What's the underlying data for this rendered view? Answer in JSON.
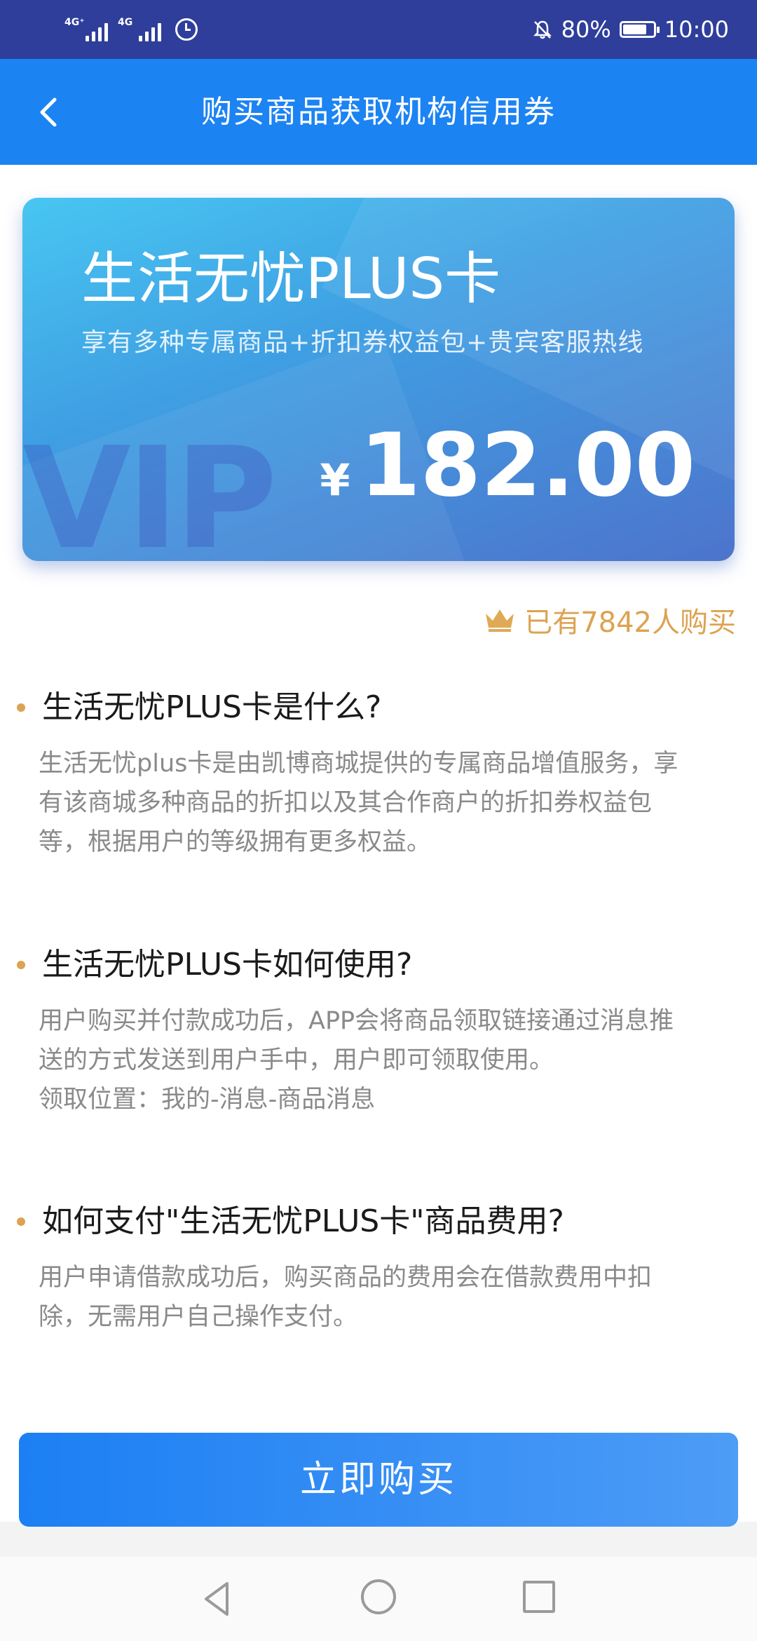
{
  "status_bar": {
    "network1": "4G⁺",
    "network2": "4G",
    "battery_percent": "80%",
    "battery_level": 0.8,
    "time": "10:00"
  },
  "header": {
    "title": "购买商品获取机构信用券"
  },
  "card": {
    "title": "生活无忧PLUS卡",
    "subtitle": "享有多种专属商品+折扣券权益包+贵宾客服热线",
    "watermark": "VIP",
    "currency": "¥",
    "price": "182.00"
  },
  "sold": {
    "text": "已有7842人购买"
  },
  "faq": [
    {
      "question": "生活无忧PLUS卡是什么?",
      "answer_lines": [
        "生活无忧plus卡是由凯博商城提供的专属商品增值服务，享",
        "有该商城多种商品的折扣以及其合作商户的折扣券权益包",
        "等，根据用户的等级拥有更多权益。"
      ]
    },
    {
      "question": "生活无忧PLUS卡如何使用?",
      "answer_lines": [
        "用户购买并付款成功后，APP会将商品领取链接通过消息推",
        "送的方式发送到用户手中，用户即可领取使用。",
        "领取位置：我的-消息-商品消息"
      ]
    },
    {
      "question": "如何支付\"生活无忧PLUS卡\"商品费用?",
      "answer_lines": [
        "用户申请借款成功后，购买商品的费用会在借款费用中扣",
        "除，无需用户自己操作支付。"
      ]
    }
  ],
  "buy_button": {
    "label": "立即购买"
  },
  "colors": {
    "status_bar": "#2e3e9a",
    "header": "#1c83f3",
    "accent_gold": "#dca352",
    "button": "#1c7ff3"
  },
  "icons": [
    "back-arrow-icon",
    "alarm-icon",
    "bell-off-icon",
    "battery-icon",
    "crown-icon",
    "nav-back-icon",
    "nav-home-icon",
    "nav-recent-icon"
  ]
}
